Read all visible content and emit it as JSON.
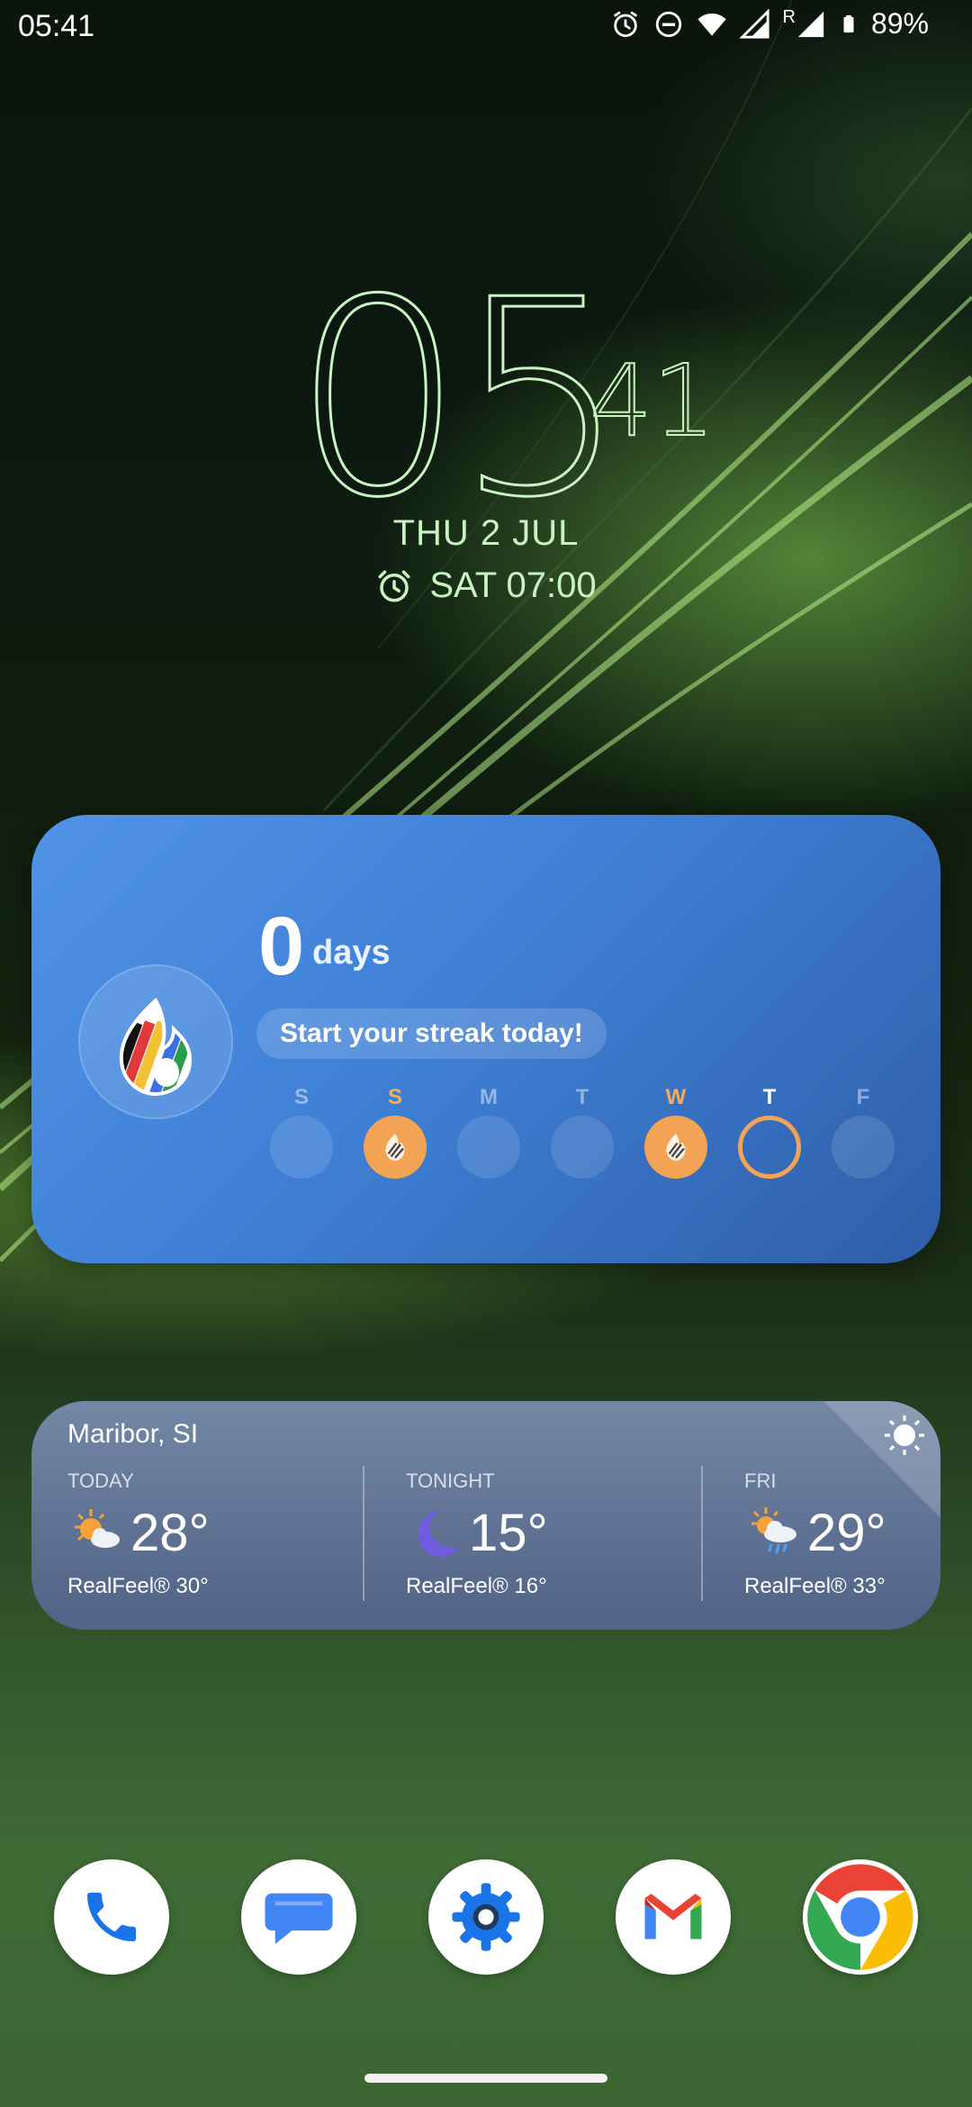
{
  "status_bar": {
    "time": "05:41",
    "roaming_label": "R",
    "battery": "89%"
  },
  "clock": {
    "hours": "05",
    "minutes": "41",
    "date": "THU 2 JUL",
    "next_alarm": "SAT 07:00"
  },
  "streak_widget": {
    "count": "0",
    "unit": "days",
    "cta": "Start your streak today!",
    "days": [
      {
        "label": "S",
        "state": "empty"
      },
      {
        "label": "S",
        "state": "done"
      },
      {
        "label": "M",
        "state": "empty"
      },
      {
        "label": "T",
        "state": "empty"
      },
      {
        "label": "W",
        "state": "done"
      },
      {
        "label": "T",
        "state": "today"
      },
      {
        "label": "F",
        "state": "empty"
      }
    ]
  },
  "weather_widget": {
    "location": "Maribor, SI",
    "periods": [
      {
        "label": "TODAY",
        "temp": "28°",
        "realfeel": "RealFeel® 30°",
        "icon": "partly-sunny-icon"
      },
      {
        "label": "TONIGHT",
        "temp": "15°",
        "realfeel": "RealFeel® 16°",
        "icon": "moon-icon"
      },
      {
        "label": "FRI",
        "temp": "29°",
        "realfeel": "RealFeel® 33°",
        "icon": "sun-rain-icon"
      }
    ]
  },
  "dock": {
    "apps": [
      "Phone",
      "Messages",
      "Settings",
      "Gmail",
      "Chrome"
    ]
  },
  "colors": {
    "clock_green": "#c9f4c2",
    "streak_accent": "#f3a354",
    "streak_bg": "#3f80d6"
  }
}
